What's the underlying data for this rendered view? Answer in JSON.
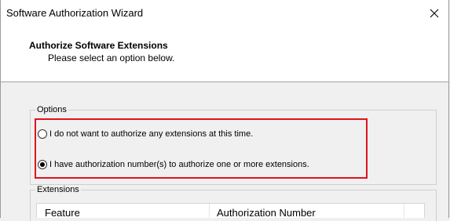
{
  "window": {
    "title": "Software Authorization Wizard",
    "close_glyph": "✕"
  },
  "header": {
    "title": "Authorize Software Extensions",
    "subtitle": "Please select an option below."
  },
  "options": {
    "legend": "Options",
    "items": [
      {
        "label": "I do not want to authorize any extensions at this time.",
        "selected": false
      },
      {
        "label": "I have authorization number(s) to authorize one or more extensions.",
        "selected": true
      }
    ]
  },
  "extensions": {
    "legend": "Extensions",
    "columns": [
      "Feature",
      "Authorization Number"
    ]
  },
  "colors": {
    "highlight": "#e0121d"
  },
  "icons": {
    "close": "close-icon"
  }
}
